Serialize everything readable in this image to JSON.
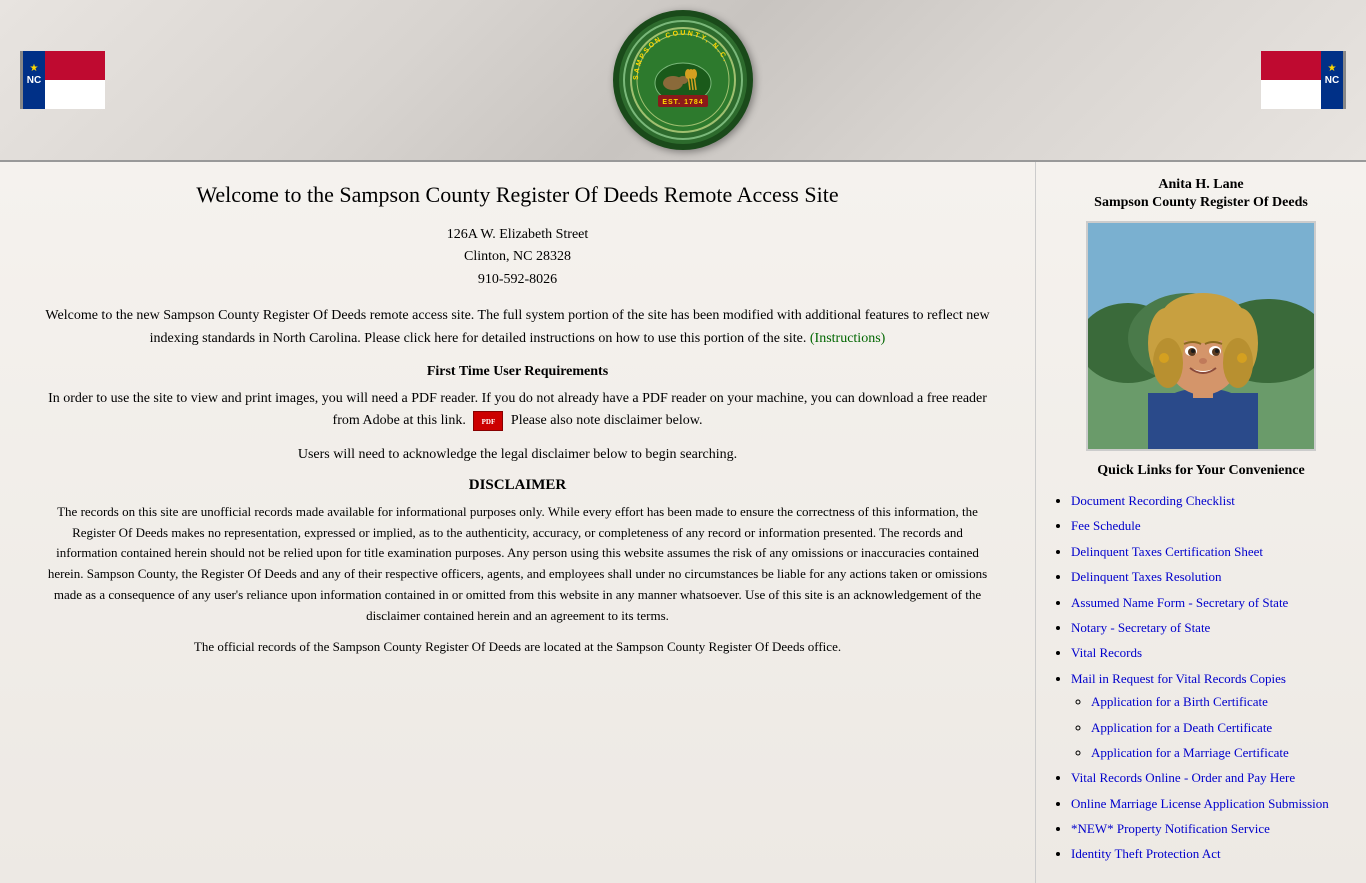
{
  "header": {
    "seal_text_line1": "SAMPSON COUNTY, N.C.",
    "seal_text_line2": "EST. 1784"
  },
  "sidebar": {
    "registrar_name": "Anita H. Lane",
    "registrar_title": "Sampson County Register Of Deeds",
    "quick_links_heading": "Quick Links for Your Convenience",
    "quick_links": [
      {
        "label": "Document Recording Checklist",
        "href": "#"
      },
      {
        "label": "Fee Schedule",
        "href": "#"
      },
      {
        "label": "Delinquent Taxes Certification Sheet",
        "href": "#"
      },
      {
        "label": "Delinquent Taxes Resolution",
        "href": "#"
      },
      {
        "label": "Assumed Name Form - Secretary of State",
        "href": "#"
      },
      {
        "label": "Notary - Secretary of State",
        "href": "#"
      },
      {
        "label": "Vital Records",
        "href": "#"
      },
      {
        "label": "Mail in Request for Vital Records Copies",
        "href": "#"
      },
      {
        "label": "Application for a Birth Certificate",
        "href": "#",
        "sub": true
      },
      {
        "label": "Application for a Death Certificate",
        "href": "#",
        "sub": true
      },
      {
        "label": "Application for a Marriage Certificate",
        "href": "#",
        "sub": true
      },
      {
        "label": "Vital Records Online - Order and Pay Here",
        "href": "#"
      },
      {
        "label": "Online Marriage License Application Submission",
        "href": "#"
      },
      {
        "label": "*NEW* Property Notification Service",
        "href": "#"
      },
      {
        "label": "Identity Theft Protection Act",
        "href": "#"
      }
    ]
  },
  "main": {
    "title": "Welcome to the Sampson County Register Of Deeds Remote Access Site",
    "address_line1": "126A W. Elizabeth Street",
    "address_line2": "Clinton, NC 28328",
    "address_line3": "910-592-8026",
    "intro": "Welcome to the new Sampson County Register Of Deeds remote access site.   The full system portion of the site has been modified with additional features to reflect new indexing standards in North Carolina. Please click here for detailed instructions on how to use this portion of the site.",
    "instructions_link": "(Instructions)",
    "first_time_heading": "First Time User Requirements",
    "first_time_text": "In order to use the site to view and print images, you will need a PDF reader. If you do not already have a PDF reader on your machine, you can download a free reader from Adobe at this link.",
    "first_time_text2": "Please also note disclaimer below.",
    "disclaimer_note": "Users will need to acknowledge the legal disclaimer below to begin searching.",
    "disclaimer_heading": "DISCLAIMER",
    "disclaimer_body1": "The records on this site are unofficial records made available for informational purposes only. While every effort has been made to ensure the correctness of this information, the Register Of Deeds makes no representation, expressed or implied, as to the authenticity, accuracy, or completeness of any record or information presented. The records and information contained herein should not be relied upon for title examination purposes. Any person using this website assumes the risk of any omissions or inaccuracies contained herein. Sampson County, the Register Of Deeds and any of their respective officers, agents, and employees shall under no circumstances be liable for any actions taken or omissions made as a consequence of any user's reliance upon information contained in or omitted from this website in any manner whatsoever. Use of this site is an acknowledgement of the disclaimer contained herein and an agreement to its terms.",
    "disclaimer_body2": "The official records of the Sampson County Register Of Deeds are located at the Sampson County Register Of Deeds office.",
    "pdf_label": "PDF"
  }
}
